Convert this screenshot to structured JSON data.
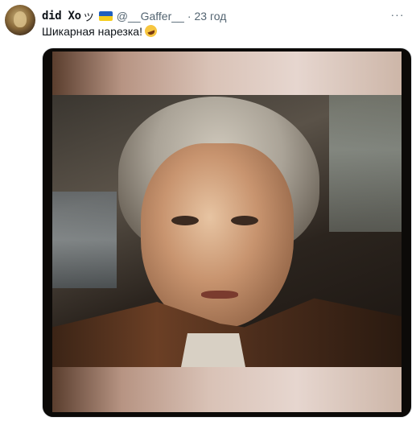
{
  "tweet": {
    "display_name": "did Xo",
    "name_emoji": "ツ",
    "flag": "ukraine-flag",
    "handle": "@__Gaffer__",
    "separator": "·",
    "time": "23 год",
    "more_label": "···",
    "text": "Шикарная нарезка!",
    "text_emoji": "rolling-on-floor-laughing-emoji"
  },
  "colors": {
    "primary_text": "#0f1419",
    "secondary_text": "#536471",
    "background": "#ffffff"
  }
}
